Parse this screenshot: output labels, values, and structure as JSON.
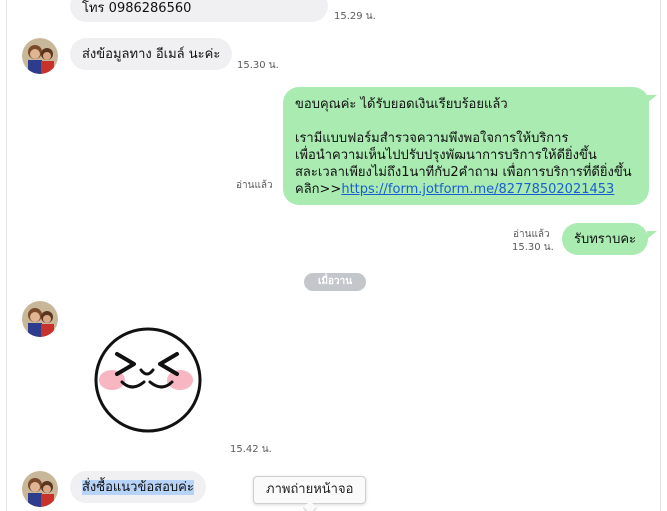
{
  "messages": {
    "m1": {
      "text": "โทร 0986286560",
      "time": "15.29 น."
    },
    "m2": {
      "text": "ส่งข้อมูลทาง อีเมล์ นะค่ะ",
      "time": "15.30 น."
    },
    "m3": {
      "line1": "ขอบคุณค่ะ ได้รับยอดเงินเรียบร้อยแล้ว",
      "line2": "เรามีแบบฟอร์มสำรวจความพึงพอใจการให้บริการ",
      "line3": "เพื่อนำความเห็นไปปรับปรุงพัฒนาการบริการให้ดียิ่งขึ้น",
      "line4": "สละเวลาเพียงไม่ถึง1นาทีกับ2คำถาม เพื่อการบริการที่ดียิ่งขึ้น",
      "line5_prefix": "คลิก>>",
      "link": "https://form.jotform.me/82778502021453",
      "read": "อ่านแล้ว"
    },
    "m4": {
      "text": "รับทราบคะ",
      "read": "อ่านแล้ว",
      "time": "15.30 น."
    },
    "date_separator": "เมื่อวาน",
    "m5": {
      "time": "15.42 น."
    },
    "m6": {
      "text": "สั่งซื้อแนวข้อสอบค่ะ"
    }
  },
  "tooltip": "ภาพถ่ายหน้าจอ",
  "colors": {
    "outgoing_bubble": "#a9ebb1",
    "incoming_bubble": "#f0f0f2",
    "link": "#1a5fd2",
    "selection": "#b7d3f7"
  }
}
